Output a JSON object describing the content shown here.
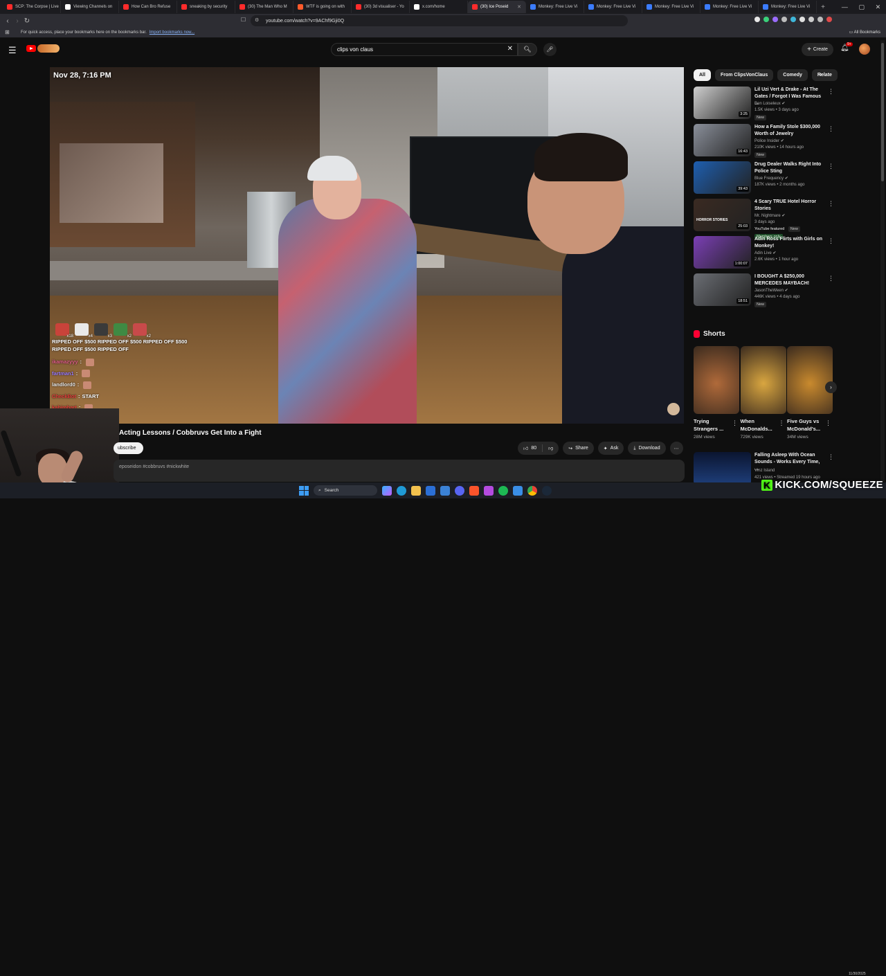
{
  "browser": {
    "tabs": [
      {
        "label": "SCP: The Corpse | Live",
        "color": "#ff2b2b",
        "active": false
      },
      {
        "label": "Viewing Channels on",
        "color": "#ffffff",
        "active": false
      },
      {
        "label": "How Can Bro Refuse",
        "color": "#ff2b2b",
        "active": false
      },
      {
        "label": "sneaking by security",
        "color": "#ff2b2b",
        "active": false
      },
      {
        "label": "(30) The Man Who M",
        "color": "#ff2b2b",
        "active": false
      },
      {
        "label": "WTF is going on with",
        "color": "#ff5a2b",
        "active": false
      },
      {
        "label": "(30) 3d visualiser - Yo",
        "color": "#ff2b2b",
        "active": false
      },
      {
        "label": "x.com/home",
        "color": "#ffffff",
        "active": false
      },
      {
        "label": "(30) Ice Poseid",
        "color": "#ff2b2b",
        "active": true
      },
      {
        "label": "Monkey: Free Live Vi",
        "color": "#3b7cff",
        "active": false
      },
      {
        "label": "Monkey: Free Live Vi",
        "color": "#3b7cff",
        "active": false
      },
      {
        "label": "Monkey: Free Live Vi",
        "color": "#3b7cff",
        "active": false
      },
      {
        "label": "Monkey: Free Live Vi",
        "color": "#3b7cff",
        "active": false
      },
      {
        "label": "Monkey: Free Live Vi",
        "color": "#3b7cff",
        "active": false
      }
    ],
    "url": "youtube.com/watch?v=9AChf9Gji0Q",
    "bookmarks_text": "For quick access, place your bookmarks here on the bookmarks bar.",
    "bookmarks_link": "Import bookmarks now...",
    "all_bookmarks": "All Bookmarks"
  },
  "youtube": {
    "search_value": "clips von claus",
    "create_label": "Create",
    "notif_count": "9+"
  },
  "player": {
    "timestamp": "Nov 28, 7:16 PM",
    "reactions": [
      {
        "count": "x18",
        "color": "#c9433a"
      },
      {
        "count": "x4",
        "color": "#e9e9e9"
      },
      {
        "count": "x3",
        "color": "#3a3a3a"
      },
      {
        "count": "x2",
        "color": "#3f8a43"
      },
      {
        "count": "x2",
        "color": "#c84a4a"
      }
    ],
    "banner": "RIPPED OFF $500 RIPPED OFF $500 RIPPED OFF $500 RIPPED OFF $500 RIPPED OFF",
    "chat": [
      {
        "user": "ikamazyyy",
        "sep": ":",
        "msg": "",
        "color": "#e05c8a"
      },
      {
        "user": "fartman1",
        "sep": ":",
        "msg": "",
        "color": "#9b7cff"
      },
      {
        "user": "landlord0",
        "sep": ":",
        "msg": "",
        "color": "#e8e8e8"
      },
      {
        "user": "CheckBot",
        "sep": ":",
        "msg": "START",
        "color": "#e03a3a"
      },
      {
        "user": "kahimbart",
        "sep": ":",
        "msg": "",
        "color": "#e03a3a"
      }
    ]
  },
  "video": {
    "title": "Acting Lessons / Cobbruvs Get Into a Fight",
    "subscribe_label": "ubscribe",
    "likes": "80",
    "share_label": "Share",
    "ask_label": "Ask",
    "download_label": "Download",
    "description": "eposeidon #cobbruvs #nickwhite"
  },
  "sidebar": {
    "chips": [
      "All",
      "From ClipsVonClaus",
      "Comedy",
      "Relate"
    ],
    "recommendations": [
      {
        "title": "Lil Uzi Vert & Drake - At The Gates / Forgot I Was Famous ...",
        "channel": "Ben Loiseleux",
        "meta": "1.5K views • 3 days ago",
        "badge": "New",
        "duration": "3:25",
        "thumb": "#cfcfcf"
      },
      {
        "title": "How a Family Stole $300,000 Worth of Jewelry",
        "channel": "Police Insider",
        "meta": "210K views • 14 hours ago",
        "badge": "New",
        "duration": "16:43",
        "thumb": "#8a8f9a"
      },
      {
        "title": "Drug Dealer Walks Right Into Police Sting",
        "channel": "Blue Frequency",
        "meta": "187K views • 2 months ago",
        "badge": "",
        "duration": "39:43",
        "thumb": "#1e5fb0"
      },
      {
        "title": "4 Scary TRUE Hotel Horror Stories",
        "channel": "Mr. Nightmare",
        "meta": "3 days ago",
        "badge": "New",
        "featured": "YouTube featured",
        "members": "Members only",
        "duration": "25:03",
        "thumb": "#3a2a22",
        "thumb_text": "HORROR STORIES"
      },
      {
        "title": "Adin Ross Flirts with Girls on Monkey!",
        "channel": "Adin Live",
        "meta": "2.6K views • 1 hour ago",
        "badge": "",
        "duration": "1:00:07",
        "thumb": "#7b3fb5"
      },
      {
        "title": "I BOUGHT A $250,000 MERCEDES MAYBACH!",
        "channel": "JasonTheWeen",
        "meta": "446K views • 4 days ago",
        "badge": "New",
        "duration": "18:51",
        "thumb": "#6b6e74"
      }
    ],
    "shorts_heading": "Shorts",
    "shorts": [
      {
        "title": "Trying Strangers ...",
        "views": "28M views",
        "color": "#b06a3a"
      },
      {
        "title": "When McDonalds...",
        "views": "729K views",
        "color": "#d9a640"
      },
      {
        "title": "Five Guys vs McDonald's...",
        "views": "34M views",
        "color": "#c98a2e"
      }
    ],
    "bottom_rec": {
      "title": "Falling Asleep With Ocean Sounds - Works Every Time, ...",
      "channel": "Vinz Island",
      "meta": "421 views • Streamed 19 hours ago"
    }
  },
  "taskbar": {
    "search_label": "Search",
    "time": "11/30/2025"
  },
  "overlay": {
    "kick_text": "KICK.COM/SQUEEZE"
  }
}
